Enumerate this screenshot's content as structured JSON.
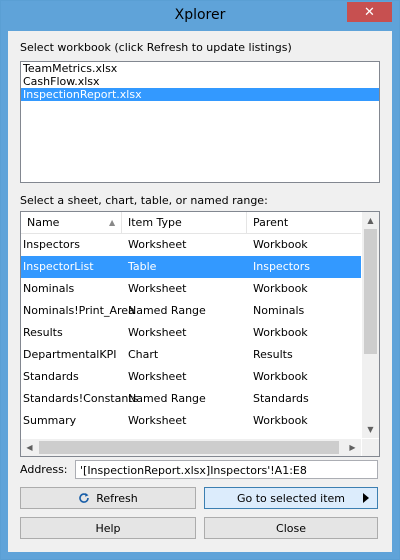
{
  "window": {
    "title": "Xplorer",
    "close_glyph": "✕"
  },
  "workbook_section": {
    "label": "Select workbook (click Refresh to update listings)",
    "items": [
      {
        "name": "TeamMetrics.xlsx",
        "selected": false
      },
      {
        "name": "CashFlow.xlsx",
        "selected": false
      },
      {
        "name": "InspectionReport.xlsx",
        "selected": true
      }
    ]
  },
  "items_section": {
    "label": "Select a sheet, chart, table, or named range:",
    "columns": {
      "name": "Name",
      "item_type": "Item Type",
      "parent": "Parent"
    },
    "rows": [
      {
        "name": "Inspectors",
        "item_type": "Worksheet",
        "parent": "Workbook",
        "selected": false
      },
      {
        "name": "InspectorList",
        "item_type": "Table",
        "parent": "Inspectors",
        "selected": true
      },
      {
        "name": "Nominals",
        "item_type": "Worksheet",
        "parent": "Workbook",
        "selected": false
      },
      {
        "name": "Nominals!Print_Area",
        "item_type": "Named Range",
        "parent": "Nominals",
        "selected": false
      },
      {
        "name": "Results",
        "item_type": "Worksheet",
        "parent": "Workbook",
        "selected": false
      },
      {
        "name": "DepartmentalKPI",
        "item_type": "Chart",
        "parent": "Results",
        "selected": false
      },
      {
        "name": "Standards",
        "item_type": "Worksheet",
        "parent": "Workbook",
        "selected": false
      },
      {
        "name": "Standards!Constants",
        "item_type": "Named Range",
        "parent": "Standards",
        "selected": false
      },
      {
        "name": "Summary",
        "item_type": "Worksheet",
        "parent": "Workbook",
        "selected": false
      }
    ]
  },
  "address": {
    "label": "Address:",
    "value": "'[InspectionReport.xlsx]Inspectors'!A1:E8"
  },
  "buttons": {
    "refresh": "Refresh",
    "goto": "Go to selected item",
    "help": "Help",
    "close": "Close"
  },
  "colors": {
    "selection": "#3399ff",
    "title_bar": "#5fa3d9",
    "close_button": "#c75050"
  }
}
